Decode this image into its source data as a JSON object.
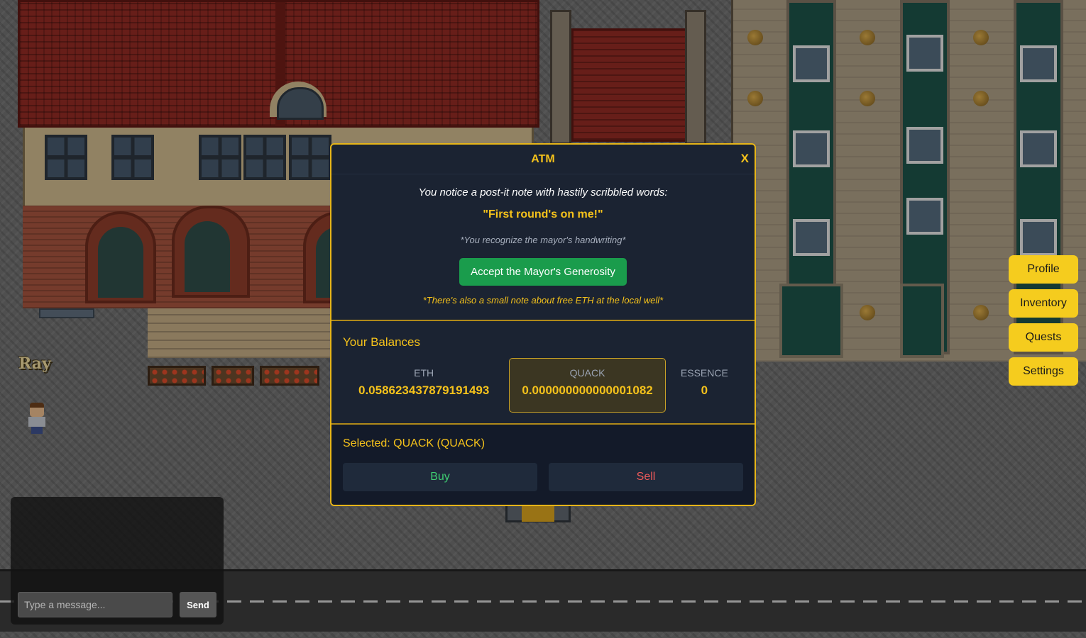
{
  "world": {
    "player_name": "Ray"
  },
  "atm": {
    "title": "ATM",
    "close_label": "X",
    "note": {
      "intro": "You notice a post-it note with hastily scribbled words:",
      "quote": "\"First round's on me!\"",
      "aside": "*You recognize the mayor's handwriting*",
      "accept_label": "Accept the Mayor's Generosity",
      "well_hint": "*There's also a small note about free ETH at the local well*"
    },
    "balances": {
      "title": "Your Balances",
      "items": [
        {
          "label": "ETH",
          "value": "0.058623437879191493"
        },
        {
          "label": "QUACK",
          "value": "0.000000000000001082",
          "selected": true
        },
        {
          "label": "ESSENCE",
          "value": "0"
        }
      ]
    },
    "selected_text": "Selected: QUACK (QUACK)",
    "buy_label": "Buy",
    "sell_label": "Sell"
  },
  "menu": {
    "items": [
      {
        "label": "Profile"
      },
      {
        "label": "Inventory"
      },
      {
        "label": "Quests"
      },
      {
        "label": "Settings"
      }
    ]
  },
  "chat": {
    "placeholder": "Type a message...",
    "send_label": "Send"
  },
  "colors": {
    "accent": "#f5c21b",
    "accept": "#1a9c4c",
    "buy": "#3fcf72",
    "sell": "#ee5a5a",
    "modal_bg": "#1b2332"
  }
}
